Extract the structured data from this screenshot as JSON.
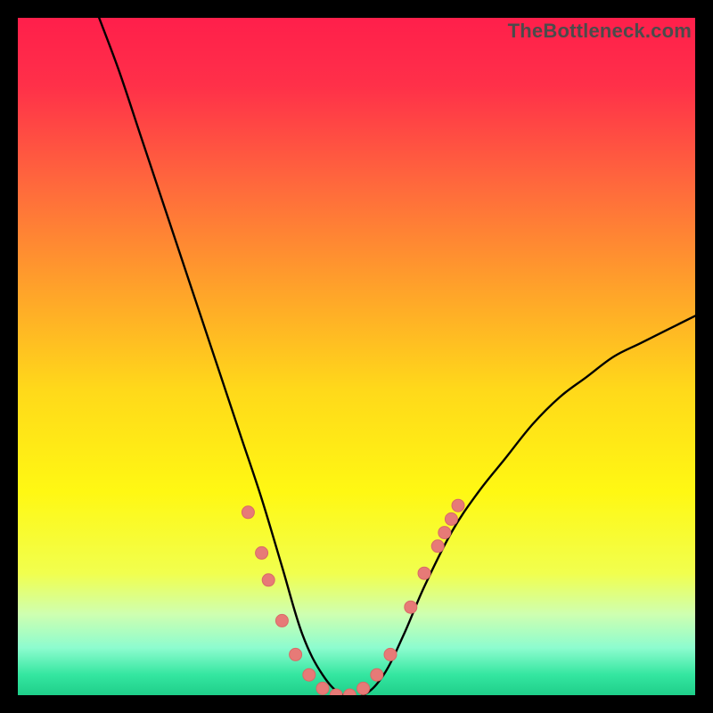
{
  "watermark": "TheBottleneck.com",
  "colors": {
    "frame": "#000000",
    "curve": "#000000",
    "dots_fill": "#e77a77",
    "dots_stroke": "#d96a67",
    "gradient_stops": [
      {
        "offset": 0.0,
        "color": "#ff1f4b"
      },
      {
        "offset": 0.1,
        "color": "#ff3049"
      },
      {
        "offset": 0.25,
        "color": "#ff6a3c"
      },
      {
        "offset": 0.4,
        "color": "#ffa22a"
      },
      {
        "offset": 0.55,
        "color": "#ffd91a"
      },
      {
        "offset": 0.7,
        "color": "#fff813"
      },
      {
        "offset": 0.82,
        "color": "#f1ff4e"
      },
      {
        "offset": 0.88,
        "color": "#cfffb0"
      },
      {
        "offset": 0.93,
        "color": "#8dfccf"
      },
      {
        "offset": 0.97,
        "color": "#34e6a0"
      },
      {
        "offset": 1.0,
        "color": "#1fcf8a"
      }
    ]
  },
  "chart_data": {
    "type": "line",
    "title": "",
    "xlabel": "",
    "ylabel": "",
    "xlim": [
      0,
      100
    ],
    "ylim": [
      0,
      100
    ],
    "grid": false,
    "legend": false,
    "annotations": [
      "TheBottleneck.com"
    ],
    "series": [
      {
        "name": "bottleneck-curve",
        "comment": "V-shaped curve; y≈100 at x≈12, drops to ~0 around x≈42–52, rises to ~56 at x≈100. Values estimated from pixel positions.",
        "x": [
          12,
          15,
          18,
          21,
          24,
          27,
          30,
          33,
          36,
          39,
          42,
          45,
          48,
          51,
          54,
          57,
          60,
          64,
          68,
          72,
          76,
          80,
          84,
          88,
          92,
          96,
          100
        ],
        "y": [
          100,
          92,
          83,
          74,
          65,
          56,
          47,
          38,
          29,
          19,
          9,
          3,
          0,
          0,
          3,
          9,
          16,
          24,
          30,
          35,
          40,
          44,
          47,
          50,
          52,
          54,
          56
        ]
      }
    ],
    "scatter_overlay": {
      "name": "highlight-dots",
      "comment": "Salmon dots clustered near the valley and along the lower legs of the V.",
      "points": [
        {
          "x": 34,
          "y": 27
        },
        {
          "x": 36,
          "y": 21
        },
        {
          "x": 37,
          "y": 17
        },
        {
          "x": 39,
          "y": 11
        },
        {
          "x": 41,
          "y": 6
        },
        {
          "x": 43,
          "y": 3
        },
        {
          "x": 45,
          "y": 1
        },
        {
          "x": 47,
          "y": 0
        },
        {
          "x": 49,
          "y": 0
        },
        {
          "x": 51,
          "y": 1
        },
        {
          "x": 53,
          "y": 3
        },
        {
          "x": 55,
          "y": 6
        },
        {
          "x": 58,
          "y": 13
        },
        {
          "x": 60,
          "y": 18
        },
        {
          "x": 62,
          "y": 22
        },
        {
          "x": 63,
          "y": 24
        },
        {
          "x": 64,
          "y": 26
        },
        {
          "x": 65,
          "y": 28
        }
      ]
    }
  }
}
